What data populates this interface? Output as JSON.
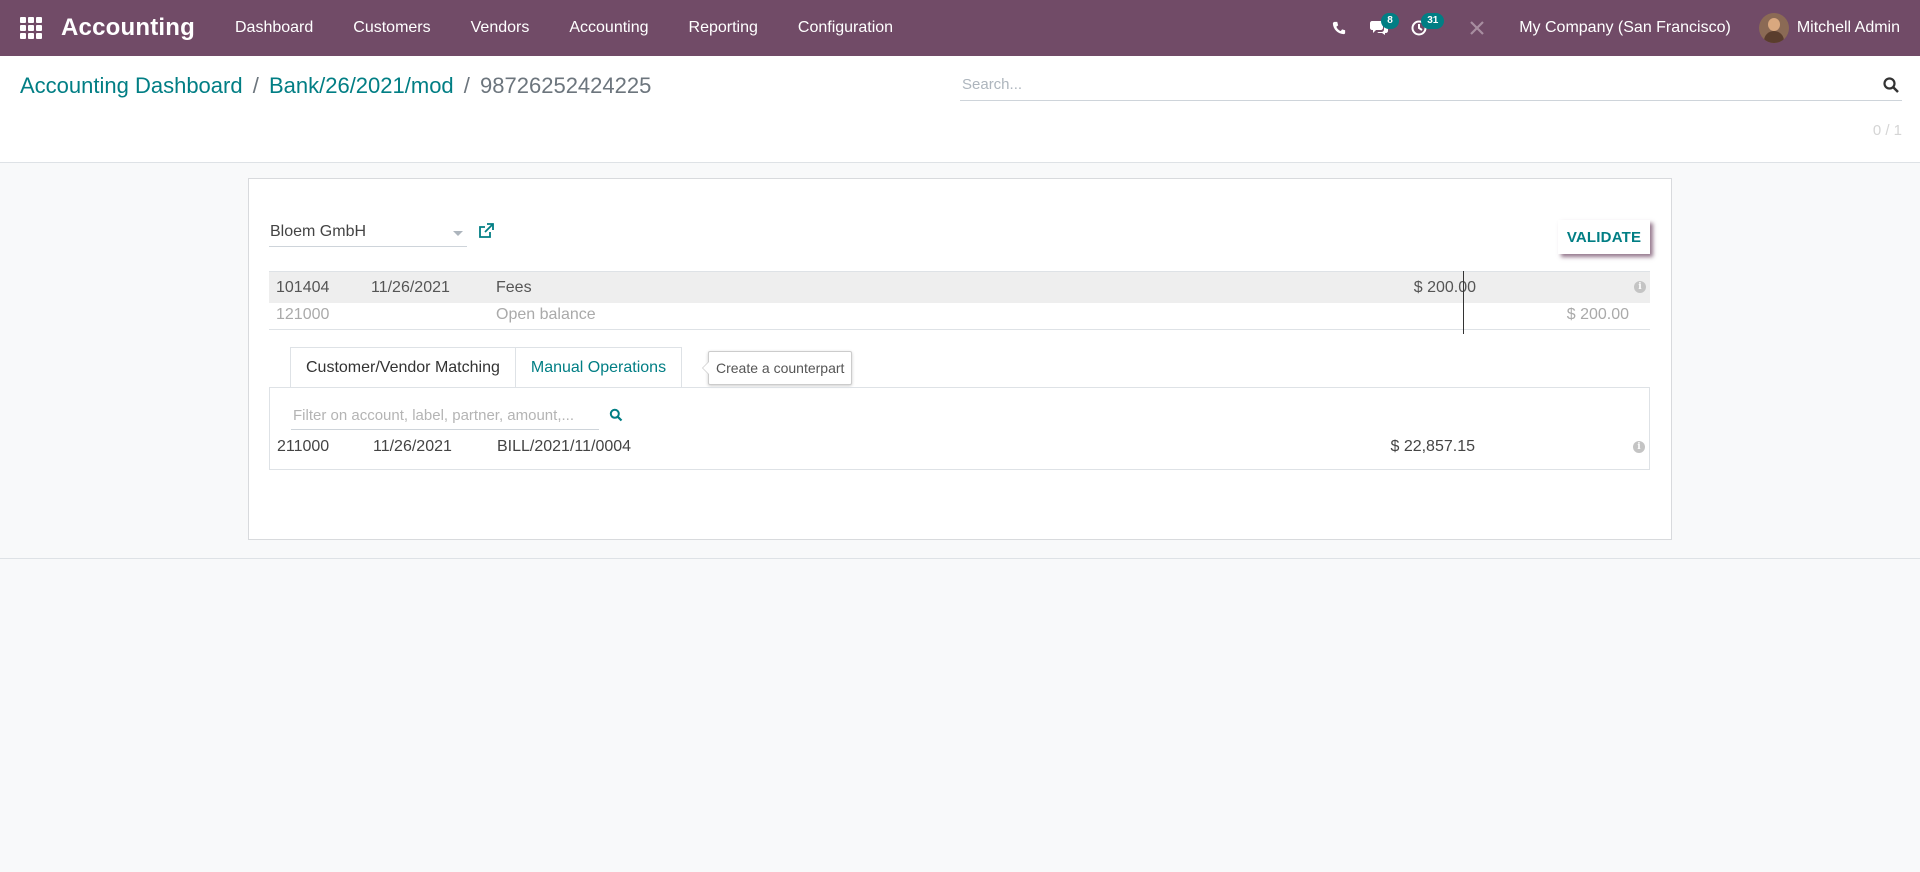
{
  "navbar": {
    "app_name": "Accounting",
    "menu": [
      "Dashboard",
      "Customers",
      "Vendors",
      "Accounting",
      "Reporting",
      "Configuration"
    ],
    "messages_count": "8",
    "activities_count": "31",
    "company": "My Company (San Francisco)",
    "user": "Mitchell Admin",
    "icons": [
      "apps-grid-icon",
      "phone-icon",
      "chat-icon",
      "clock-icon",
      "wrench-icon"
    ]
  },
  "breadcrumb": {
    "items": [
      "Accounting Dashboard",
      "Bank/26/2021/mod"
    ],
    "current": "98726252424225",
    "separator": "/"
  },
  "search": {
    "placeholder": "Search..."
  },
  "pager": "0 / 1",
  "reconcile": {
    "partner": "Bloem GmbH",
    "validate_label": "VALIDATE",
    "lines": [
      {
        "account": "101404",
        "date": "11/26/2021",
        "label": "Fees",
        "debit": "$ 200.00",
        "credit": ""
      },
      {
        "account": "121000",
        "date": "",
        "label": "Open balance",
        "debit": "",
        "credit": "$ 200.00"
      }
    ],
    "tabs": [
      "Customer/Vendor Matching",
      "Manual Operations"
    ],
    "tooltip": "Create a counterpart",
    "filter_placeholder": "Filter on account, label, partner, amount,...",
    "matches": [
      {
        "account": "211000",
        "date": "11/26/2021",
        "ref": "BILL/2021/11/0004",
        "amount": "$ 22,857.15"
      }
    ]
  },
  "colors": {
    "brand": "#714b67",
    "accent": "#017e84"
  }
}
